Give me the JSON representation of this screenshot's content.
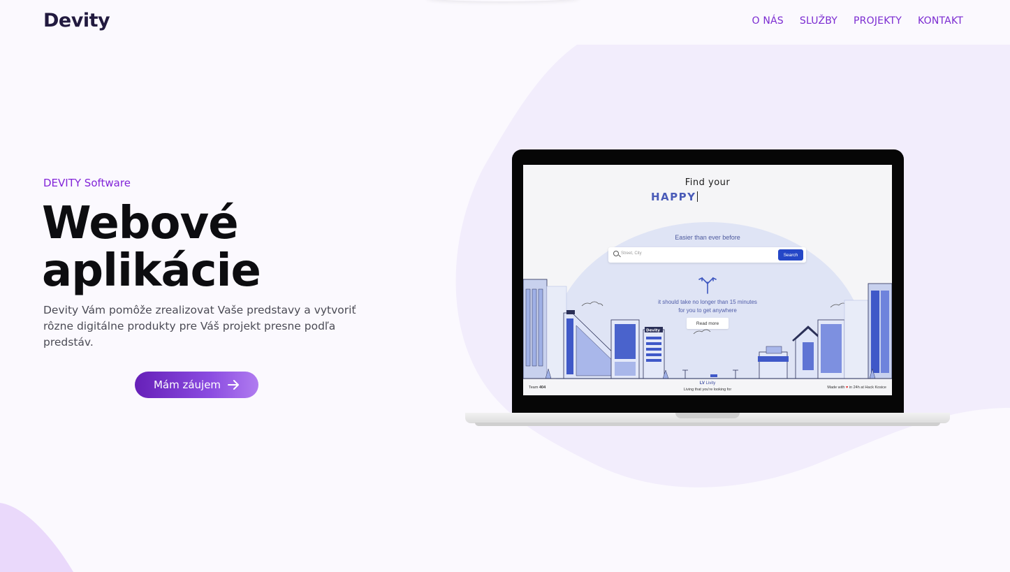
{
  "brand": {
    "logo_text": "Devity"
  },
  "nav": {
    "items": [
      {
        "label": "O NÁS"
      },
      {
        "label": "SLUŽBY"
      },
      {
        "label": "PROJEKTY"
      },
      {
        "label": "KONTAKT"
      }
    ]
  },
  "hero": {
    "eyebrow": "DEVITY Software",
    "headline_line1": "Webové",
    "headline_line2": "aplikácie",
    "description": "Devity Vám pomôže zrealizovat Vaše predstavy a vytvoriť rôzne digitálne produkty pre Váš projekt presne podľa predstáv.",
    "cta_label": "Mám záujem",
    "cta_icon": "arrow-right-icon"
  },
  "showcase": {
    "title": "Find your",
    "typed_word": "HAPPY",
    "subtitle": "Easier than ever before",
    "search_placeholder": "Street, City",
    "search_button": "Search",
    "tagline_line1": "it should take no longer than 15 minutes",
    "tagline_line2": "for you to get anywhere",
    "read_more": "Read more",
    "building_sign": "Devity",
    "footer_team_prefix": "Team",
    "footer_team_number": "404",
    "footer_brand_mark": "LV",
    "footer_brand_name": "Livity",
    "footer_slogan": "Living that you're looking for",
    "footer_made_prefix": "Made with",
    "footer_made_suffix": "in 24h at Hack Kosice"
  },
  "colors": {
    "accent": "#7b2bd1",
    "button_gradient_start": "#6620b8",
    "button_gradient_end": "#b07cf0",
    "blob": "#f1ecfc",
    "showcase_blue": "#2547c7"
  }
}
